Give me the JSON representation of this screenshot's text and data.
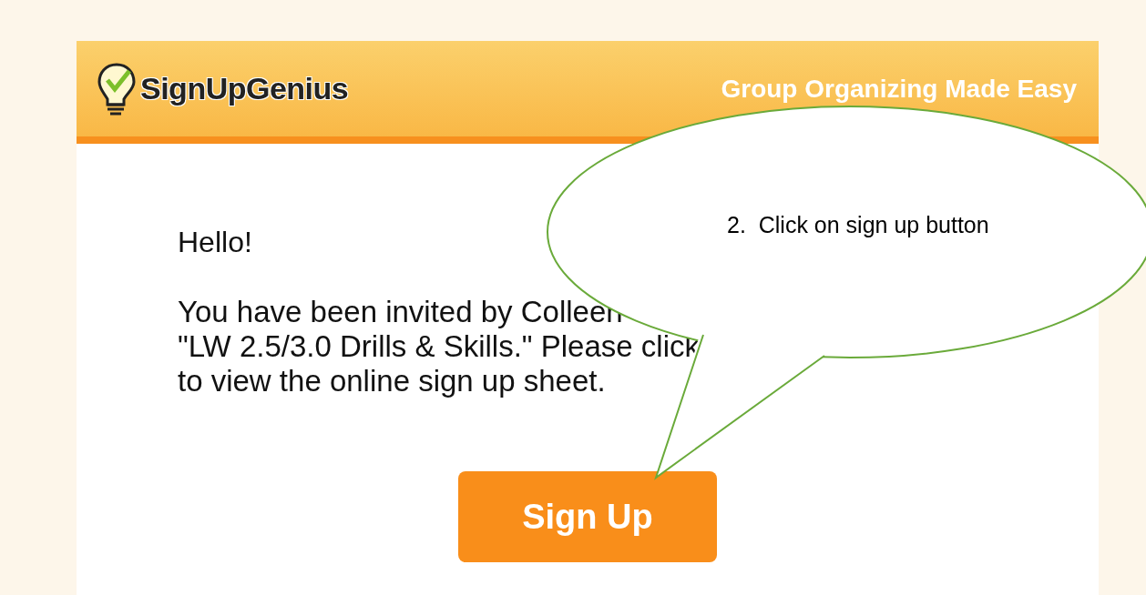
{
  "header": {
    "logo_text": "SignUpGenius",
    "tagline": "Group Organizing Made Easy"
  },
  "message": {
    "greeting": "Hello!",
    "lines": [
      "You have been invited by Colleen",
      "\"LW 2.5/3.0 Drills & Skills.\" Please click",
      "to view the online sign up sheet."
    ]
  },
  "button": {
    "label": "Sign Up"
  },
  "callout": {
    "text": "2.  Click on sign up button"
  }
}
